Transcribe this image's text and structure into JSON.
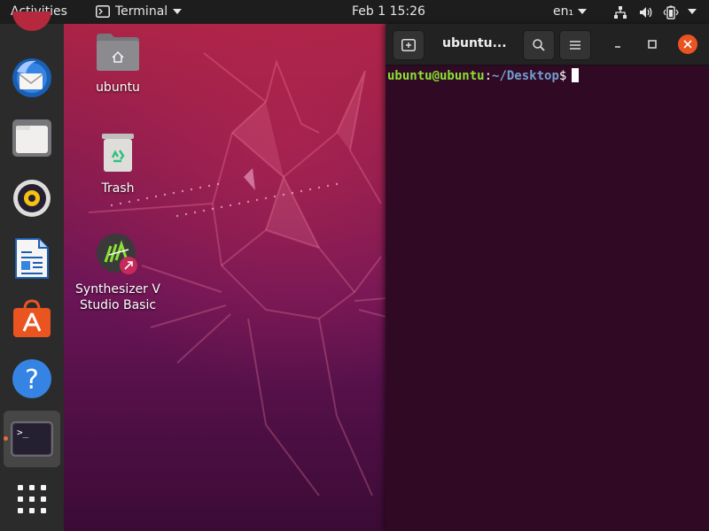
{
  "topbar": {
    "activities": "Activities",
    "app_name": "Terminal",
    "clock": "Feb 1  15:26",
    "language": "en₁",
    "icons": [
      "terminal-app-icon",
      "chevron-down-icon",
      "network-icon",
      "volume-icon",
      "battery-icon",
      "power-menu-chevron-icon"
    ]
  },
  "dock": {
    "items": [
      "thunderbird",
      "files",
      "rhythmbox",
      "libreoffice-writer",
      "ubuntu-software",
      "help",
      "terminal",
      "show-applications"
    ],
    "active": "terminal",
    "accent": "#e95420"
  },
  "desktop": {
    "icons": [
      {
        "label": "ubuntu",
        "icon": "home-folder-icon"
      },
      {
        "label": "Trash",
        "icon": "trash-icon"
      },
      {
        "label": "Synthesizer V Studio Basic",
        "line1": "Synthesizer V",
        "line2": "Studio Basic",
        "icon": "synthesizer-v-icon"
      }
    ]
  },
  "terminal": {
    "title": "ubuntu...",
    "prompt_user": "ubuntu@ubuntu",
    "prompt_sep": ":",
    "prompt_path": "~/Desktop",
    "prompt_symbol": "$",
    "colors": {
      "background": "#300a24",
      "user": "#8ae234",
      "path": "#729fcf",
      "close": "#e95420"
    }
  }
}
